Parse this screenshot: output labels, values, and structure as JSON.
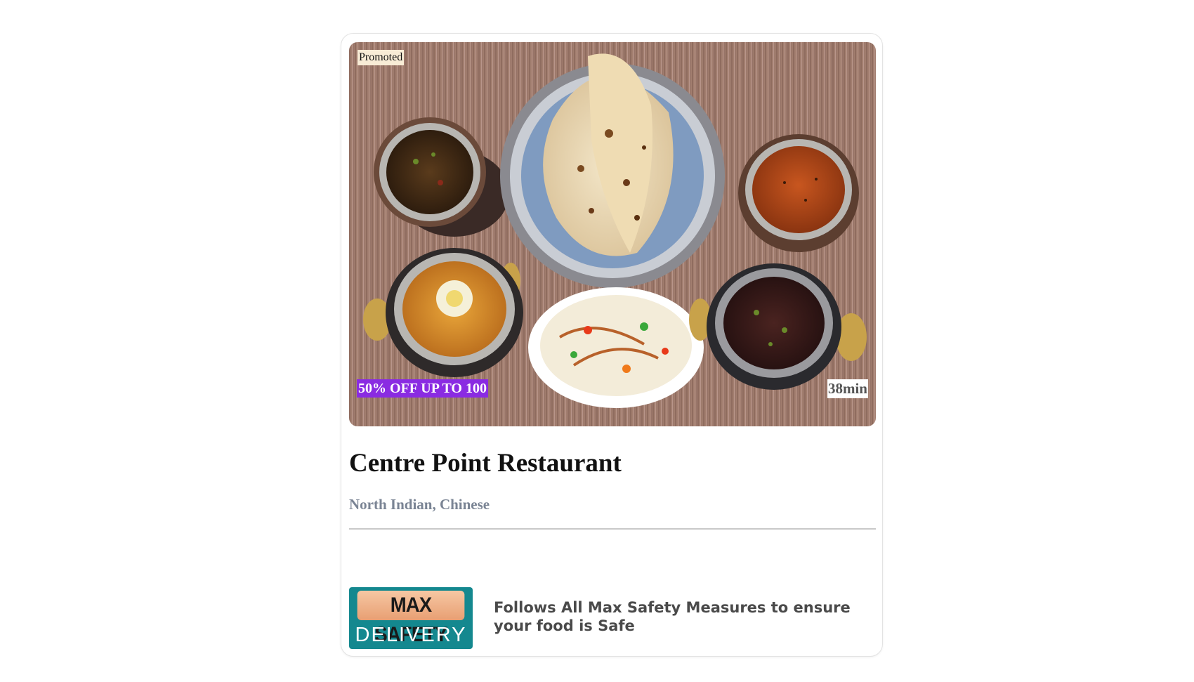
{
  "restaurant": {
    "badge_promoted": "Promoted",
    "offer": "50% OFF UP TO 100",
    "delivery_time": "38min",
    "name": "Centre Point Restaurant",
    "cuisines": "North Indian, Chinese"
  },
  "safety": {
    "logo_top": "MAX SAFETY",
    "logo_bottom": "DELIVERY",
    "message": "Follows All Max Safety Measures to ensure your food is Safe"
  },
  "colors": {
    "offer_bg": "#8a2be2",
    "cuisine_text": "#7a8494",
    "safety_teal": "#14888f",
    "safety_peach": "#f6c7a3"
  }
}
